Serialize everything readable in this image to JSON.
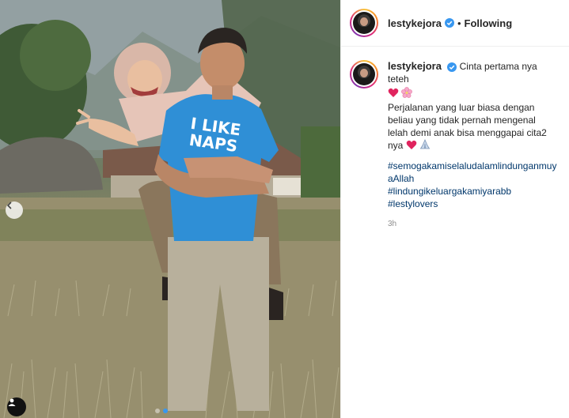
{
  "post": {
    "username": "lestykejora",
    "separator": "•",
    "follow_state": "Following",
    "caption_title": "Cinta pertama nya teteh",
    "caption_body_1": "Perjalanan yang luar biasa dengan beliau yang tidak pernah mengenal lelah demi anak bisa menggapai cita2 nya",
    "hashtags": [
      "#semogakamiselaludalamlindunganmuyaAllah",
      "#lindungikeluargakamiyarabb",
      "#lestylovers"
    ],
    "time_ago": "3h",
    "shirt_text_line1": "I LIKE",
    "shirt_text_line2": "NAPS"
  },
  "icons": {
    "verified": "verified-badge-icon",
    "heart": "red-heart-emoji",
    "flower": "cherry-blossom-emoji",
    "hands": "folded-hands-emoji",
    "prev": "chevron-left-icon",
    "tag": "user-tag-icon"
  },
  "colors": {
    "verified_blue": "#3897f0",
    "hashtag": "#00376b",
    "shirt_blue": "#2f8fd6",
    "heart_red": "#e0245e",
    "muted": "#8e8e8e"
  },
  "carousel": {
    "current": 1,
    "total": 2
  }
}
